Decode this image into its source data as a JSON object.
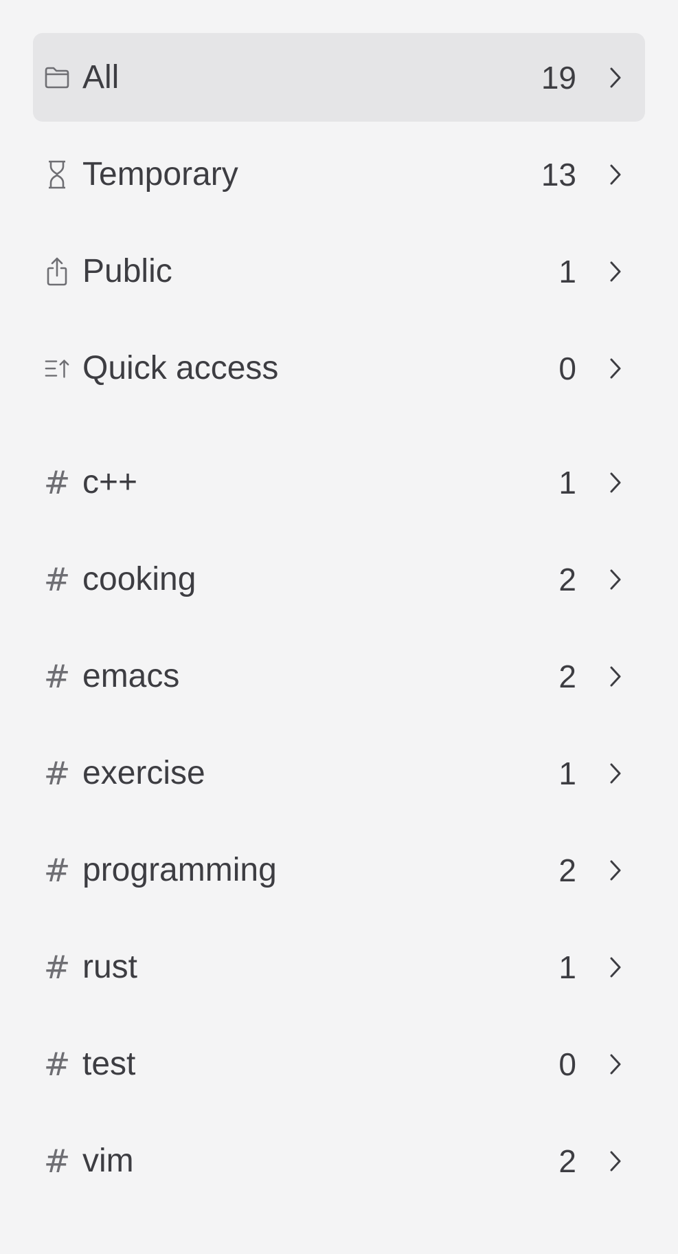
{
  "smart_folders": [
    {
      "label": "All",
      "count": "19",
      "icon": "folder-icon",
      "selected": true
    },
    {
      "label": "Temporary",
      "count": "13",
      "icon": "hourglass-icon",
      "selected": false
    },
    {
      "label": "Public",
      "count": "1",
      "icon": "share-icon",
      "selected": false
    },
    {
      "label": "Quick access",
      "count": "0",
      "icon": "sort-up-icon",
      "selected": false
    }
  ],
  "tags": [
    {
      "label": "c++",
      "count": "1",
      "icon": "hash-icon"
    },
    {
      "label": "cooking",
      "count": "2",
      "icon": "hash-icon"
    },
    {
      "label": "emacs",
      "count": "2",
      "icon": "hash-icon"
    },
    {
      "label": "exercise",
      "count": "1",
      "icon": "hash-icon"
    },
    {
      "label": "programming",
      "count": "2",
      "icon": "hash-icon"
    },
    {
      "label": "rust",
      "count": "1",
      "icon": "hash-icon"
    },
    {
      "label": "test",
      "count": "0",
      "icon": "hash-icon"
    },
    {
      "label": "vim",
      "count": "2",
      "icon": "hash-icon"
    }
  ],
  "hash_symbol": "#",
  "colors": {
    "background": "#f4f4f5",
    "selected_row": "#e5e5e7",
    "text": "#3d3d42",
    "icon": "#6e6e73"
  }
}
